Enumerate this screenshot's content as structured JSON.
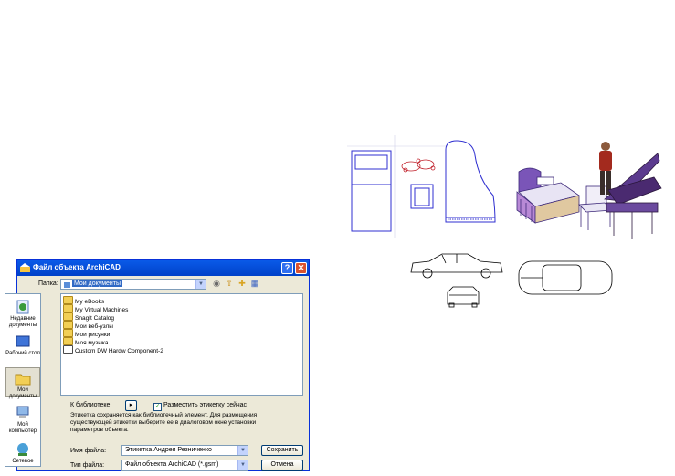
{
  "dialog": {
    "title": "Файл объекта ArchiCAD",
    "help_label": "?",
    "close_label": "✕",
    "folder_label": "Папка:",
    "folder_value": "Мои документы",
    "places": [
      {
        "label": "Недавние документы",
        "icon": "recent-documents-icon"
      },
      {
        "label": "Рабочий стол",
        "icon": "desktop-icon"
      },
      {
        "label": "Мои документы",
        "icon": "my-documents-icon"
      },
      {
        "label": "Мой компьютер",
        "icon": "my-computer-icon"
      },
      {
        "label": "Сетевое",
        "icon": "network-icon"
      }
    ],
    "files": [
      {
        "name": "My eBooks",
        "icon": "folder-icon"
      },
      {
        "name": "My Virtual Machines",
        "icon": "folder-icon"
      },
      {
        "name": "SnagIt Catalog",
        "icon": "folder-icon"
      },
      {
        "name": "Мои веб-узлы",
        "icon": "folder-icon"
      },
      {
        "name": "Мои рисунки",
        "icon": "folder-icon"
      },
      {
        "name": "Моя музыка",
        "icon": "folder-icon"
      },
      {
        "name": "Custom DW Hardw Component-2",
        "icon": "archicad-object-icon"
      }
    ],
    "library_label": "К библиотеке:",
    "place_label_now": "Разместить этикетку сейчас",
    "place_label_checked": true,
    "info_text": "Этикетка сохраняется как библиотечный элемент. Для размещения существующей этикетки выберите ее в диалоговом окне установки параметров объекта.",
    "filename_label": "Имя файла:",
    "filename_value": "Этикетка Андрея Резниченко",
    "filetype_label": "Тип файла:",
    "filetype_value": "Файл объекта ArchiCAD (*.gsm)",
    "save_label": "Сохранить",
    "cancel_label": "Отмена"
  },
  "colors": {
    "titlebar": "#0a5ae8",
    "dialog_bg": "#ece9d8",
    "selection": "#316ac5",
    "cad_line": "#2f2fd0",
    "furniture_3d": "#5b3a8e"
  }
}
